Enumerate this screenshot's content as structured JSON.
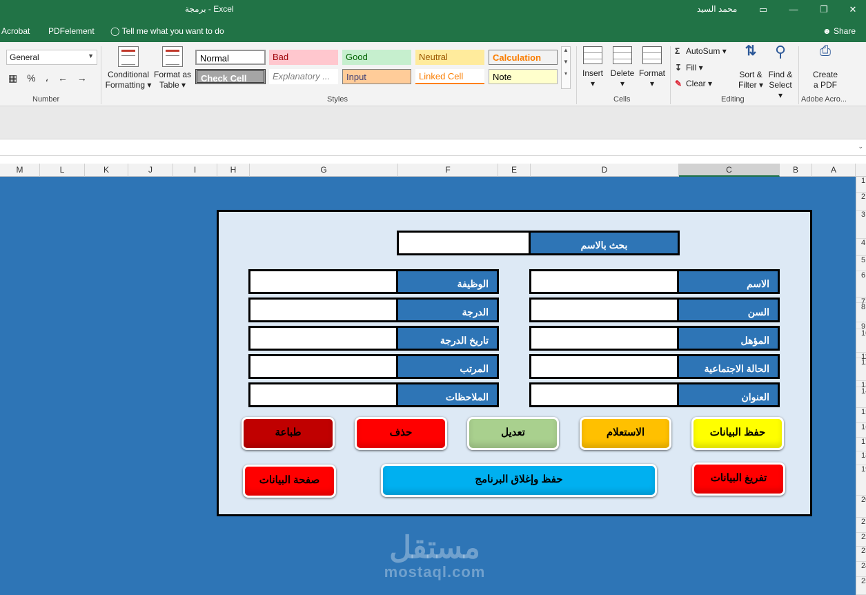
{
  "window": {
    "doc_title": "برمجة  -  Excel",
    "user": "محمد السيد",
    "controls": [
      "▭",
      "—",
      "❐",
      "✕"
    ]
  },
  "tabs": {
    "items": [
      "Acrobat",
      "PDFelement"
    ],
    "tell_me": "Tell me what you want to do",
    "share": "Share"
  },
  "ribbon": {
    "number": {
      "format_value": "General",
      "group_label": "Number",
      "percent": "%",
      "comma": "،"
    },
    "conditional_formatting": [
      "Conditional",
      "Formatting ▾"
    ],
    "format_as_table": [
      "Format as",
      "Table ▾"
    ],
    "styles": {
      "group_label": "Styles",
      "cells": [
        {
          "label": "Normal",
          "bg": "#ffffff",
          "fg": "#000000"
        },
        {
          "label": "Bad",
          "bg": "#ffc7ce",
          "fg": "#9c0006"
        },
        {
          "label": "Good",
          "bg": "#c6efce",
          "fg": "#006100"
        },
        {
          "label": "Neutral",
          "bg": "#ffeb9c",
          "fg": "#9c5700"
        },
        {
          "label": "Calculation",
          "bg": "#f2f2f2",
          "fg": "#fa7d00"
        },
        {
          "label": "Check Cell",
          "bg": "#a5a5a5",
          "fg": "#ffffff"
        },
        {
          "label": "Explanatory ...",
          "bg": "#ffffff",
          "fg": "#7f7f7f"
        },
        {
          "label": "Input",
          "bg": "#ffcc99",
          "fg": "#3f3f76"
        },
        {
          "label": "Linked Cell",
          "bg": "#ffffff",
          "fg": "#fa7d00"
        },
        {
          "label": "Note",
          "bg": "#ffffcc",
          "fg": "#000000"
        }
      ]
    },
    "cells": {
      "group_label": "Cells",
      "insert": "Insert",
      "delete": "Delete",
      "format": "Format"
    },
    "editing": {
      "group_label": "Editing",
      "autosum": "AutoSum ▾",
      "fill": "Fill ▾",
      "clear": "Clear ▾",
      "sort_filter": [
        "Sort &",
        "Filter ▾"
      ],
      "find_select": [
        "Find &",
        "Select ▾"
      ]
    },
    "adobe": {
      "group_label": "Adobe Acro...",
      "create_pdf": [
        "Create",
        "a PDF"
      ]
    }
  },
  "columns": [
    "M",
    "L",
    "K",
    "J",
    "I",
    "H",
    "G",
    "F",
    "E",
    "D",
    "C",
    "B",
    "A"
  ],
  "rows": [
    "1",
    "2",
    "3",
    "4",
    "5",
    "6",
    "7",
    "8",
    "9",
    "10",
    "11",
    "12",
    "13",
    "14",
    "15",
    "16",
    "17",
    "18",
    "19",
    "20",
    "21",
    "22",
    "23",
    "24",
    "25"
  ],
  "form": {
    "search": {
      "label": "بحث بالاسم",
      "value": ""
    },
    "fields_right": [
      {
        "label": "الاسم",
        "value": ""
      },
      {
        "label": "السن",
        "value": ""
      },
      {
        "label": "المؤهل",
        "value": ""
      },
      {
        "label": "الحالة الاجتماعية",
        "value": ""
      },
      {
        "label": "العنوان",
        "value": ""
      }
    ],
    "fields_left": [
      {
        "label": "الوظيفة",
        "value": ""
      },
      {
        "label": "الدرجة",
        "value": ""
      },
      {
        "label": "تاريخ الدرجة",
        "value": ""
      },
      {
        "label": "المرتب",
        "value": ""
      },
      {
        "label": "الملاحظات",
        "value": ""
      }
    ],
    "buttons": {
      "save": {
        "label": "حفظ البيانات",
        "color": "#ffff00"
      },
      "query": {
        "label": "الاستعلام",
        "color": "#ffc000"
      },
      "edit": {
        "label": "تعديل",
        "color": "#a9d08e"
      },
      "delete": {
        "label": "حذف",
        "color": "#ff0000"
      },
      "print": {
        "label": "طباعة",
        "color": "#c00000"
      },
      "clear": {
        "label": "تفريغ البيانات",
        "color": "#ff0000"
      },
      "save_close": {
        "label": "حفظ وإغلاق البرنامج",
        "color": "#00b0f0"
      },
      "data_page": {
        "label": "صفحة البيانات",
        "color": "#ff0000"
      }
    }
  },
  "watermark": {
    "arabic": "مستقل",
    "latin": "mostaql.com"
  },
  "colors": {
    "excel_green": "#217346",
    "sheet_blue": "#2e75b6",
    "panel_bg": "#dde9f5"
  }
}
